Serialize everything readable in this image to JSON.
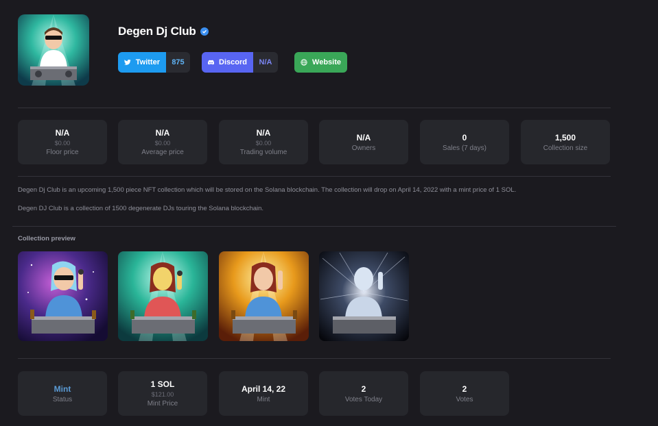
{
  "collection": {
    "name": "Degen Dj Club",
    "verified": true
  },
  "socials": {
    "twitter": {
      "label": "Twitter",
      "count": "875",
      "color": "#1d9bf0"
    },
    "discord": {
      "label": "Discord",
      "count": "N/A",
      "color": "#5865f2"
    },
    "website": {
      "label": "Website",
      "color": "#3aa758"
    }
  },
  "stats": [
    {
      "value": "N/A",
      "sub": "$0.00",
      "label": "Floor price"
    },
    {
      "value": "N/A",
      "sub": "$0.00",
      "label": "Average price"
    },
    {
      "value": "N/A",
      "sub": "$0.00",
      "label": "Trading volume"
    },
    {
      "value": "N/A",
      "sub": "",
      "label": "Owners"
    },
    {
      "value": "0",
      "sub": "",
      "label": "Sales (7 days)"
    },
    {
      "value": "1,500",
      "sub": "",
      "label": "Collection size"
    }
  ],
  "description": {
    "line1": "Degen Dj Club is an upcoming 1,500 piece NFT collection which will be stored on the Solana blockchain. The collection will drop on April 14, 2022 with a mint price of 1 SOL.",
    "line2": "Degen DJ Club is a collection of 1500 degenerate DJs touring the Solana blockchain."
  },
  "preview": {
    "label": "Collection preview",
    "items": [
      {
        "theme": "galaxy-blue-hair"
      },
      {
        "theme": "green-stage-red-hair"
      },
      {
        "theme": "orange-stage-red-hair"
      },
      {
        "theme": "space-silver"
      }
    ]
  },
  "mint_stats": [
    {
      "value": "Mint",
      "sub": "",
      "label": "Status",
      "accent": "#5b9bd5"
    },
    {
      "value": "1 SOL",
      "sub": "$121.00",
      "label": "Mint Price"
    },
    {
      "value": "April 14, 22",
      "sub": "",
      "label": "Mint"
    },
    {
      "value": "2",
      "sub": "",
      "label": "Votes Today"
    },
    {
      "value": "2",
      "sub": "",
      "label": "Votes"
    }
  ]
}
